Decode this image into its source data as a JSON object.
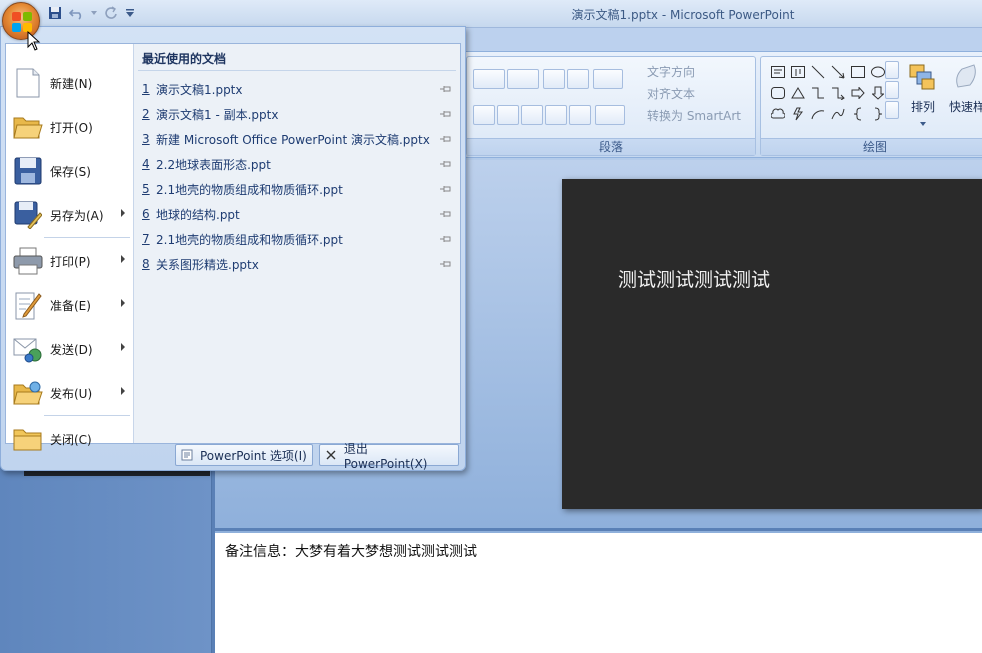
{
  "window": {
    "title": "演示文稿1.pptx - Microsoft PowerPoint"
  },
  "ribbon": {
    "text_direction": "文字方向",
    "align_text": "对齐文本",
    "convert_smartart": "转换为 SmartArt",
    "paragraph_group": "段落",
    "drawing_group": "绘图",
    "arrange": "排列",
    "quick_styles": "快速样"
  },
  "office_menu": {
    "commands": [
      {
        "label": "新建(N)",
        "icon": "new-icon"
      },
      {
        "label": "打开(O)",
        "icon": "open-folder-icon"
      },
      {
        "label": "保存(S)",
        "icon": "save-icon"
      },
      {
        "label": "另存为(A)",
        "icon": "save-as-icon",
        "submenu": true
      },
      {
        "label": "打印(P)",
        "icon": "print-icon",
        "submenu": true
      },
      {
        "label": "准备(E)",
        "icon": "prepare-icon",
        "submenu": true
      },
      {
        "label": "发送(D)",
        "icon": "send-icon",
        "submenu": true
      },
      {
        "label": "发布(U)",
        "icon": "publish-icon",
        "submenu": true
      },
      {
        "label": "关闭(C)",
        "icon": "close-folder-icon"
      }
    ],
    "recent_header": "最近使用的文档",
    "recent": [
      {
        "num": "1",
        "name": "演示文稿1.pptx"
      },
      {
        "num": "2",
        "name": "演示文稿1 - 副本.pptx"
      },
      {
        "num": "3",
        "name": "新建 Microsoft Office PowerPoint 演示文稿.pptx"
      },
      {
        "num": "4",
        "name": "2.2地球表面形态.ppt"
      },
      {
        "num": "5",
        "name": "2.1地壳的物质组成和物质循环.ppt"
      },
      {
        "num": "6",
        "name": "地球的结构.ppt"
      },
      {
        "num": "7",
        "name": "2.1地壳的物质组成和物质循环.ppt"
      },
      {
        "num": "8",
        "name": "关系图形精选.pptx"
      }
    ],
    "options_button": "PowerPoint 选项(I)",
    "exit_button": "退出 PowerPoint(X)"
  },
  "slide": {
    "text": "测试测试测试测试"
  },
  "notes": {
    "text": "备注信息：大梦有着大梦想测试测试测试"
  }
}
